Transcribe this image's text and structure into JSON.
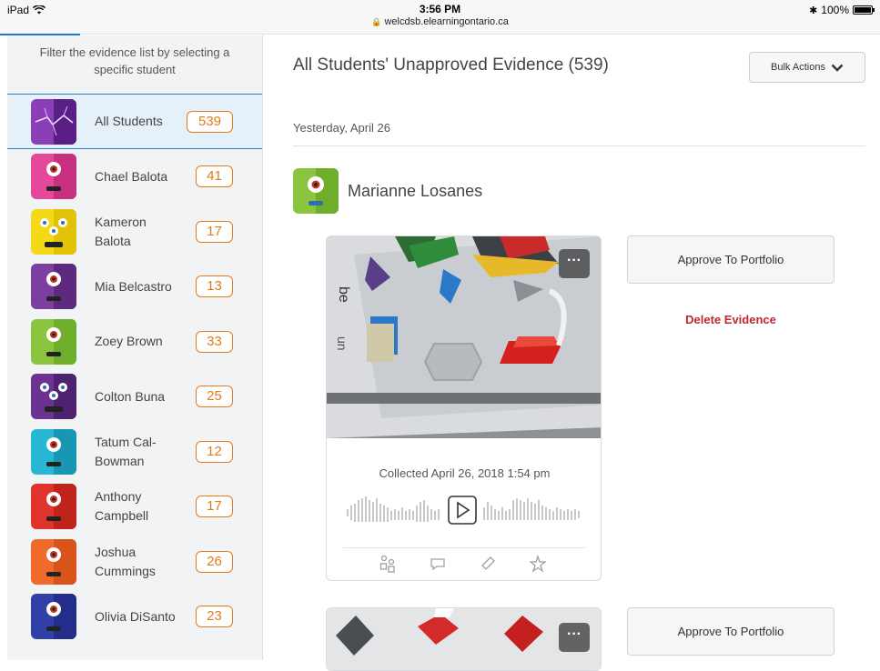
{
  "statusbar": {
    "device": "iPad",
    "time": "3:56 PM",
    "url": "welcdsb.elearningontario.ca",
    "battery": "100%"
  },
  "sidebar": {
    "filter_text": "Filter the evidence list by selecting a specific student",
    "students": [
      {
        "name": "All Students",
        "count": "539",
        "avatar": "lightning-icon",
        "active": true
      },
      {
        "name": "Chael Balota",
        "count": "41",
        "avatar": "pink-monster-icon"
      },
      {
        "name": "Kameron Balota",
        "count": "17",
        "avatar": "yellow-monster-icon"
      },
      {
        "name": "Mia Belcastro",
        "count": "13",
        "avatar": "purple-monster-icon"
      },
      {
        "name": "Zoey Brown",
        "count": "33",
        "avatar": "green-monster-icon"
      },
      {
        "name": "Colton Buna",
        "count": "25",
        "avatar": "violet-monster-icon"
      },
      {
        "name": "Tatum Cal-Bowman",
        "count": "12",
        "avatar": "teal-monster-icon"
      },
      {
        "name": "Anthony Campbell",
        "count": "17",
        "avatar": "red-monster-icon"
      },
      {
        "name": "Joshua Cummings",
        "count": "26",
        "avatar": "orange-monster-icon"
      },
      {
        "name": "Olivia DiSanto",
        "count": "23",
        "avatar": "blue-monster-icon"
      }
    ]
  },
  "main": {
    "title": "All Students' Unapproved Evidence (539)",
    "bulk_actions": "Bulk Actions",
    "date_header": "Yesterday, April 26",
    "student_name": "Marianne Losanes",
    "collected": "Collected April 26, 2018 1:54 pm",
    "more_label": "···",
    "approve_label": "Approve To Portfolio",
    "delete_label": "Delete Evidence"
  },
  "colors": {
    "accent": "#2a7fc9",
    "badge": "#e07c1b",
    "delete": "#c1272d"
  }
}
